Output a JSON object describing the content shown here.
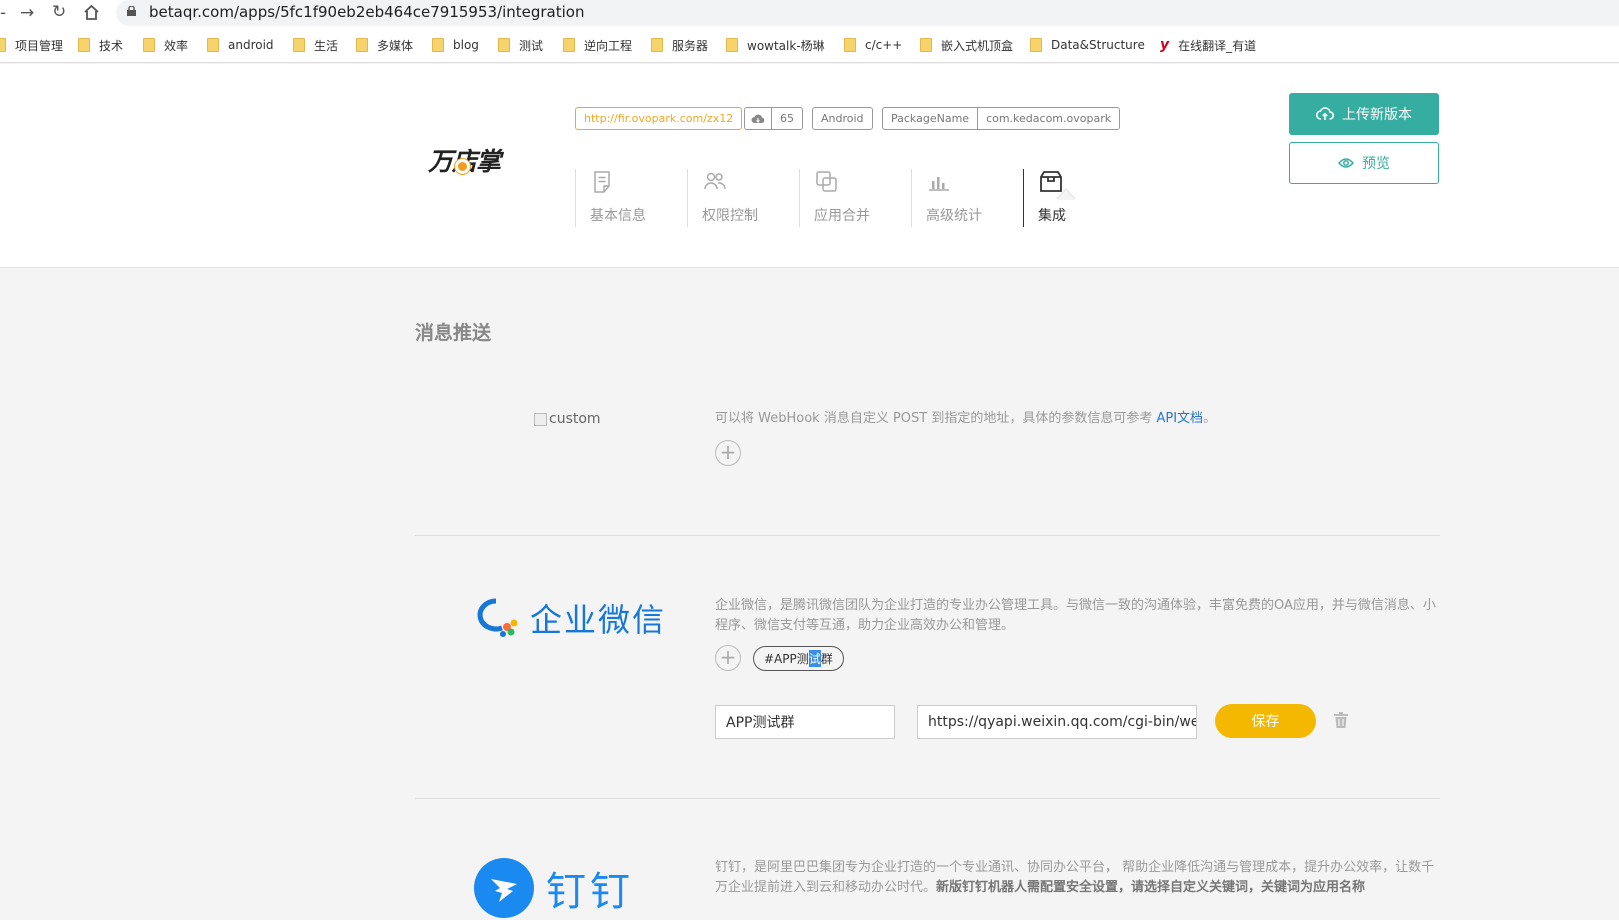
{
  "browser": {
    "url": "betaqr.com/apps/5fc1f90eb2eb464ce7915953/integration",
    "bookmarks": [
      "项目管理",
      "技术",
      "效率",
      "android",
      "生活",
      "多媒体",
      "blog",
      "测试",
      "逆向工程",
      "服务器",
      "wowtalk-杨琳",
      "c/c++",
      "嵌入式机顶盒",
      "Data&Structure",
      "在线翻译_有道"
    ]
  },
  "app": {
    "logo": "万店掌",
    "short_link": "http://fir.ovopark.com/zx12",
    "download_count": "65",
    "platform": "Android",
    "package_label": "PackageName",
    "package_name": "com.kedacom.ovopark",
    "upload_label": "上传新版本",
    "preview_label": "预览"
  },
  "tabs": [
    {
      "label": "基本信息",
      "icon": "document-icon"
    },
    {
      "label": "权限控制",
      "icon": "users-icon"
    },
    {
      "label": "应用合并",
      "icon": "merge-icon"
    },
    {
      "label": "高级统计",
      "icon": "bar-chart-icon"
    },
    {
      "label": "集成",
      "icon": "box-icon",
      "active": true
    }
  ],
  "section": {
    "title": "消息推送"
  },
  "custom": {
    "image_alt": "custom",
    "desc_prefix": "可以将 WebHook 消息自定义 POST 到指定的地址，具体的参数信息可参考 ",
    "doc_link": "API文档",
    "desc_suffix": "。"
  },
  "wecom": {
    "name": "企业微信",
    "desc": "企业微信，是腾讯微信团队为企业打造的专业办公管理工具。与微信一致的沟通体验，丰富免费的OA应用，并与微信消息、小程序、微信支付等互通，助力企业高效办公和管理。",
    "tag_pre": "#APP测",
    "tag_hl": "试",
    "tag_post": "群",
    "name_value": "APP测试群",
    "webhook_value": "https://qyapi.weixin.qq.com/cgi-bin/webhook/send?key=",
    "save_label": "保存"
  },
  "dingtalk": {
    "name": "钉钉",
    "desc_plain": "钉钉，是阿里巴巴集团专为企业打造的一个专业通讯、协同办公平台， 帮助企业降低沟通与管理成本，提升办公效率，让数千万企业提前进入到云和移动办公时代。",
    "desc_bold": "新版钉钉机器人需配置安全设置，请选择自定义关键词，关键词为应用名称"
  }
}
